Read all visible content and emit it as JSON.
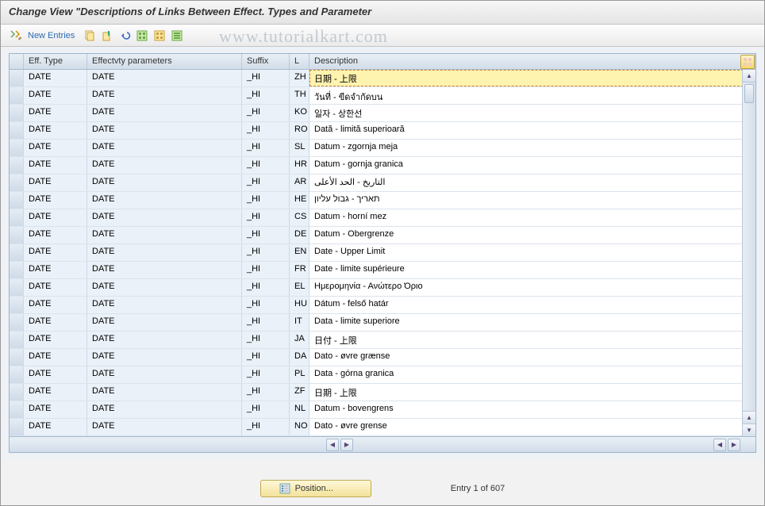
{
  "title": "Change View \"Descriptions of Links Between Effect. Types and Parameter",
  "toolbar": {
    "new_entries": "New Entries"
  },
  "watermark": "www.tutorialkart.com",
  "headers": {
    "eff_type": "Eff. Type",
    "eff_params": "Effectvty parameters",
    "suffix": "Suffix",
    "lang": "L",
    "description": "Description"
  },
  "rows": [
    {
      "eff": "DATE",
      "params": "DATE",
      "suffix": "_HI",
      "lang": "ZH",
      "desc": "日期 - 上限"
    },
    {
      "eff": "DATE",
      "params": "DATE",
      "suffix": "_HI",
      "lang": "TH",
      "desc": "วันที่ - ขีดจำกัดบน"
    },
    {
      "eff": "DATE",
      "params": "DATE",
      "suffix": "_HI",
      "lang": "KO",
      "desc": "일자 - 상한선"
    },
    {
      "eff": "DATE",
      "params": "DATE",
      "suffix": "_HI",
      "lang": "RO",
      "desc": "Dată - limită superioară"
    },
    {
      "eff": "DATE",
      "params": "DATE",
      "suffix": "_HI",
      "lang": "SL",
      "desc": "Datum - zgornja meja"
    },
    {
      "eff": "DATE",
      "params": "DATE",
      "suffix": "_HI",
      "lang": "HR",
      "desc": "Datum - gornja granica"
    },
    {
      "eff": "DATE",
      "params": "DATE",
      "suffix": "_HI",
      "lang": "AR",
      "desc": "التاريخ - الحد الأعلى"
    },
    {
      "eff": "DATE",
      "params": "DATE",
      "suffix": "_HI",
      "lang": "HE",
      "desc": "תאריך - גבול עליון"
    },
    {
      "eff": "DATE",
      "params": "DATE",
      "suffix": "_HI",
      "lang": "CS",
      "desc": "Datum - horní mez"
    },
    {
      "eff": "DATE",
      "params": "DATE",
      "suffix": "_HI",
      "lang": "DE",
      "desc": "Datum - Obergrenze"
    },
    {
      "eff": "DATE",
      "params": "DATE",
      "suffix": "_HI",
      "lang": "EN",
      "desc": "Date - Upper Limit"
    },
    {
      "eff": "DATE",
      "params": "DATE",
      "suffix": "_HI",
      "lang": "FR",
      "desc": "Date - limite supérieure"
    },
    {
      "eff": "DATE",
      "params": "DATE",
      "suffix": "_HI",
      "lang": "EL",
      "desc": "Ημερομηνία - Ανώτερο Όριο"
    },
    {
      "eff": "DATE",
      "params": "DATE",
      "suffix": "_HI",
      "lang": "HU",
      "desc": "Dátum - felső határ"
    },
    {
      "eff": "DATE",
      "params": "DATE",
      "suffix": "_HI",
      "lang": "IT",
      "desc": "Data - limite superiore"
    },
    {
      "eff": "DATE",
      "params": "DATE",
      "suffix": "_HI",
      "lang": "JA",
      "desc": "日付 - 上限"
    },
    {
      "eff": "DATE",
      "params": "DATE",
      "suffix": "_HI",
      "lang": "DA",
      "desc": "Dato - øvre grænse"
    },
    {
      "eff": "DATE",
      "params": "DATE",
      "suffix": "_HI",
      "lang": "PL",
      "desc": "Data - górna granica"
    },
    {
      "eff": "DATE",
      "params": "DATE",
      "suffix": "_HI",
      "lang": "ZF",
      "desc": "日期 - 上限"
    },
    {
      "eff": "DATE",
      "params": "DATE",
      "suffix": "_HI",
      "lang": "NL",
      "desc": "Datum - bovengrens"
    },
    {
      "eff": "DATE",
      "params": "DATE",
      "suffix": "_HI",
      "lang": "NO",
      "desc": "Dato - øvre grense"
    }
  ],
  "footer": {
    "position_btn": "Position...",
    "entry_text": "Entry 1 of 607"
  }
}
